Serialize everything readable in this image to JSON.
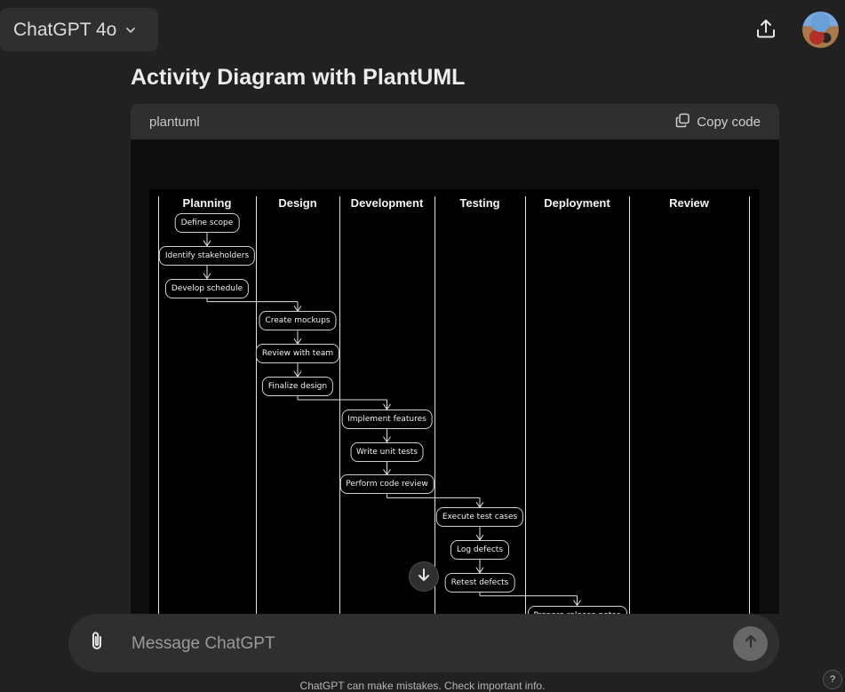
{
  "header": {
    "model_label": "ChatGPT 4o",
    "model_icon": "chevron-down-icon",
    "share_icon": "share-icon",
    "avatar_icon": "avatar"
  },
  "conversation": {
    "title": "Activity Diagram with PlantUML"
  },
  "code_block": {
    "language": "plantuml",
    "copy_label": "Copy code",
    "copy_icon": "copy-icon"
  },
  "diagram": {
    "lanes": [
      "Planning",
      "Design",
      "Development",
      "Testing",
      "Deployment",
      "Review"
    ],
    "activities": [
      {
        "lane": 0,
        "label": "Define scope"
      },
      {
        "lane": 0,
        "label": "Identify stakeholders"
      },
      {
        "lane": 0,
        "label": "Develop schedule"
      },
      {
        "lane": 1,
        "label": "Create mockups"
      },
      {
        "lane": 1,
        "label": "Review with team"
      },
      {
        "lane": 1,
        "label": "Finalize design"
      },
      {
        "lane": 2,
        "label": "Implement features"
      },
      {
        "lane": 2,
        "label": "Write unit tests"
      },
      {
        "lane": 2,
        "label": "Perform code review"
      },
      {
        "lane": 3,
        "label": "Execute test cases"
      },
      {
        "lane": 3,
        "label": "Log defects"
      },
      {
        "lane": 3,
        "label": "Retest defects"
      },
      {
        "lane": 4,
        "label": "Prepare release notes"
      }
    ]
  },
  "composer": {
    "placeholder": "Message ChatGPT",
    "attach_icon": "paperclip-icon",
    "send_icon": "arrow-up-icon",
    "scroll_icon": "arrow-down-icon"
  },
  "footer": {
    "disclaimer": "ChatGPT can make mistakes. Check important info.",
    "help_label": "?"
  },
  "colors": {
    "background": "#212121",
    "surface": "#2f2f2f",
    "code_background": "#0d0d0d",
    "diagram_background": "#000000"
  }
}
